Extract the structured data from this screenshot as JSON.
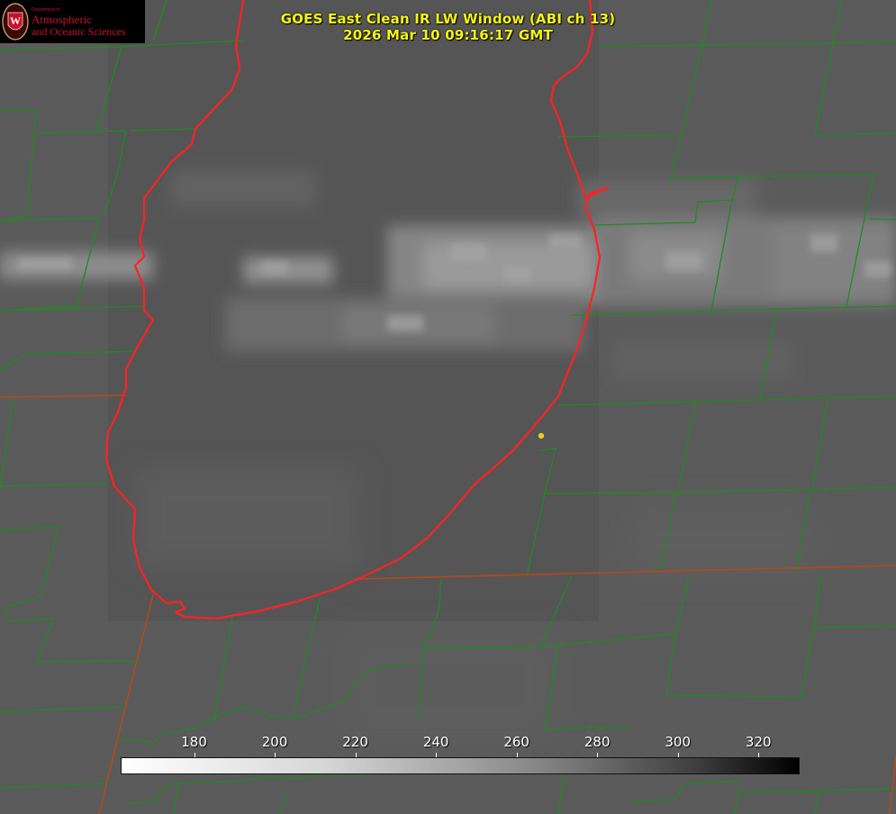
{
  "title": {
    "line1": "GOES East Clean IR LW Window (ABI ch 13)",
    "line2": "2026 Mar 10 09:16:17 GMT"
  },
  "logo": {
    "department": "Department of",
    "line1": "Atmospheric",
    "line2": "and Oceanic Sciences",
    "seal_letter": "W"
  },
  "colorbar": {
    "min": 162,
    "max": 330,
    "ticks": [
      {
        "value": 180,
        "label": "180"
      },
      {
        "value": 200,
        "label": "200"
      },
      {
        "value": 220,
        "label": "220"
      },
      {
        "value": 240,
        "label": "240"
      },
      {
        "value": 260,
        "label": "260"
      },
      {
        "value": 280,
        "label": "280"
      },
      {
        "value": 300,
        "label": "300"
      },
      {
        "value": 320,
        "label": "320"
      }
    ]
  },
  "colors": {
    "county_lines": "#1e8c1e",
    "state_lines": "#b34a1a",
    "coastline": "#ff2020",
    "title_text": "#f5f510",
    "marker": "#e0d020",
    "logo_red": "#c8102e"
  }
}
